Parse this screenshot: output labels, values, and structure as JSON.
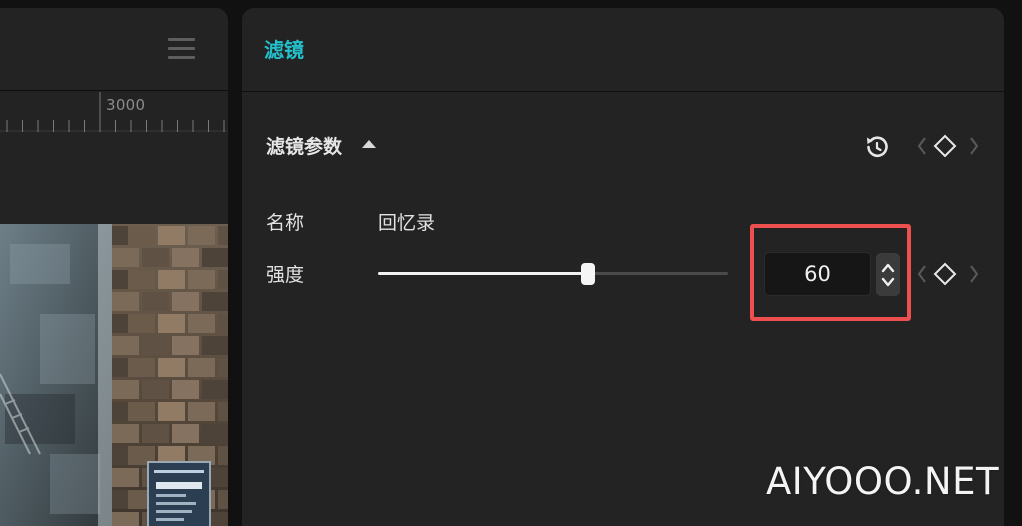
{
  "theme": {
    "accent": "#23c0cd",
    "highlight": "#ee4f4f",
    "panel_bg": "#232323",
    "app_bg": "#111111"
  },
  "left_panel": {
    "menu_icon": "menu-icon",
    "ruler": {
      "label": "3000"
    }
  },
  "filter_panel": {
    "title": "滤镜",
    "section": {
      "title": "滤镜参数",
      "expanded": true,
      "reset_icon": "reset-icon",
      "keyframe_icons": [
        "chevron-left-icon",
        "diamond-keyframe-icon",
        "chevron-right-icon"
      ]
    },
    "name_field": {
      "label": "名称",
      "value": "回忆录"
    },
    "intensity_field": {
      "label": "强度",
      "value": "60",
      "slider_percent": 60,
      "stepper_icon": "stepper-up-down-icon"
    }
  },
  "watermark": "AIYOOO.NET"
}
